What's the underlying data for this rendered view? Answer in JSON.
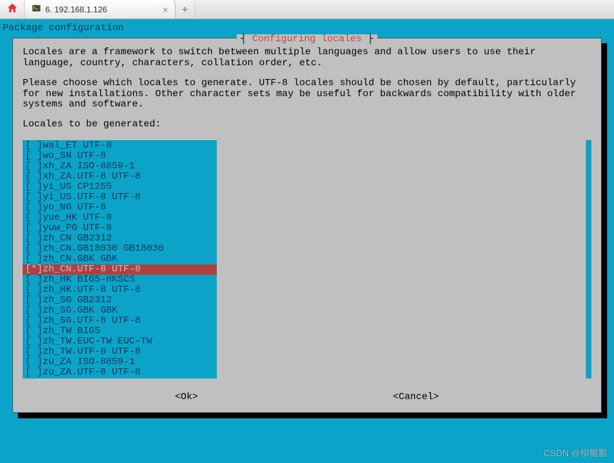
{
  "browser": {
    "tab_title": "6. 192.168.1.126"
  },
  "terminal": {
    "header": "Package configuration",
    "dialog_title": "Configuring locales",
    "paragraph1": "Locales are a framework to switch between multiple languages and allow users to use their language, country, characters, collation order, etc.",
    "paragraph2": "Please choose which locales to generate. UTF-8 locales should be chosen by default, particularly for new installations. Other character sets may be useful for backwards compatibility with older systems and software.",
    "list_label": "Locales to be generated:",
    "ok_label": "<Ok>",
    "cancel_label": "<Cancel>",
    "locales": [
      {
        "checked": false,
        "selected": false,
        "label": "wal_ET UTF-8"
      },
      {
        "checked": false,
        "selected": false,
        "label": "wo_SN UTF-8"
      },
      {
        "checked": false,
        "selected": false,
        "label": "xh_ZA ISO-8859-1"
      },
      {
        "checked": false,
        "selected": false,
        "label": "xh_ZA.UTF-8 UTF-8"
      },
      {
        "checked": false,
        "selected": false,
        "label": "yi_US CP1255"
      },
      {
        "checked": false,
        "selected": false,
        "label": "yi_US.UTF-8 UTF-8"
      },
      {
        "checked": false,
        "selected": false,
        "label": "yo_NG UTF-8"
      },
      {
        "checked": false,
        "selected": false,
        "label": "yue_HK UTF-8"
      },
      {
        "checked": false,
        "selected": false,
        "label": "yuw_PG UTF-8"
      },
      {
        "checked": false,
        "selected": false,
        "label": "zh_CN GB2312"
      },
      {
        "checked": false,
        "selected": false,
        "label": "zh_CN.GB18030 GB18030"
      },
      {
        "checked": false,
        "selected": false,
        "label": "zh_CN.GBK GBK"
      },
      {
        "checked": true,
        "selected": true,
        "label": "zh_CN.UTF-8 UTF-8"
      },
      {
        "checked": false,
        "selected": false,
        "label": "zh_HK BIG5-HKSCS"
      },
      {
        "checked": false,
        "selected": false,
        "label": "zh_HK.UTF-8 UTF-8"
      },
      {
        "checked": false,
        "selected": false,
        "label": "zh_SG GB2312"
      },
      {
        "checked": false,
        "selected": false,
        "label": "zh_SG.GBK GBK"
      },
      {
        "checked": false,
        "selected": false,
        "label": "zh_SG.UTF-8 UTF-8"
      },
      {
        "checked": false,
        "selected": false,
        "label": "zh_TW BIG5"
      },
      {
        "checked": false,
        "selected": false,
        "label": "zh_TW.EUC-TW EUC-TW"
      },
      {
        "checked": false,
        "selected": false,
        "label": "zh_TW.UTF-8 UTF-8"
      },
      {
        "checked": false,
        "selected": false,
        "label": "zu_ZA ISO-8859-1"
      },
      {
        "checked": false,
        "selected": false,
        "label": "zu_ZA.UTF-8 UTF-8"
      }
    ]
  },
  "watermark": "CSDN @柳鲲鹏"
}
